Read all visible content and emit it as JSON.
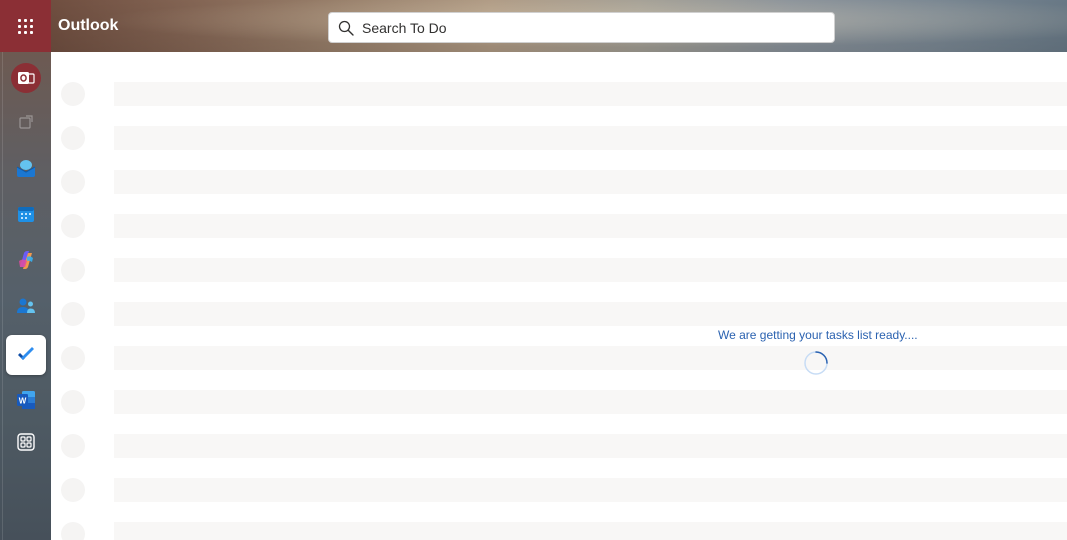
{
  "app": {
    "title": "Outlook"
  },
  "search": {
    "placeholder": "Search To Do",
    "value": ""
  },
  "rail": {
    "items": [
      {
        "name": "outlook",
        "icon": "outlook-icon"
      },
      {
        "name": "new-window",
        "icon": "pop-out-icon"
      },
      {
        "name": "mail",
        "icon": "mail-icon"
      },
      {
        "name": "calendar",
        "icon": "calendar-icon"
      },
      {
        "name": "copilot",
        "icon": "copilot-icon"
      },
      {
        "name": "people",
        "icon": "people-icon"
      },
      {
        "name": "to-do",
        "icon": "todo-check-icon",
        "active": true
      },
      {
        "name": "word",
        "icon": "word-icon"
      },
      {
        "name": "more-apps",
        "icon": "apps-grid-icon"
      }
    ]
  },
  "status": {
    "loading_message": "We are getting your tasks list ready...."
  },
  "colors": {
    "brand_red": "#8b2f35",
    "accent_blue": "#2b62b0",
    "todo_blue": "#2564cf"
  }
}
